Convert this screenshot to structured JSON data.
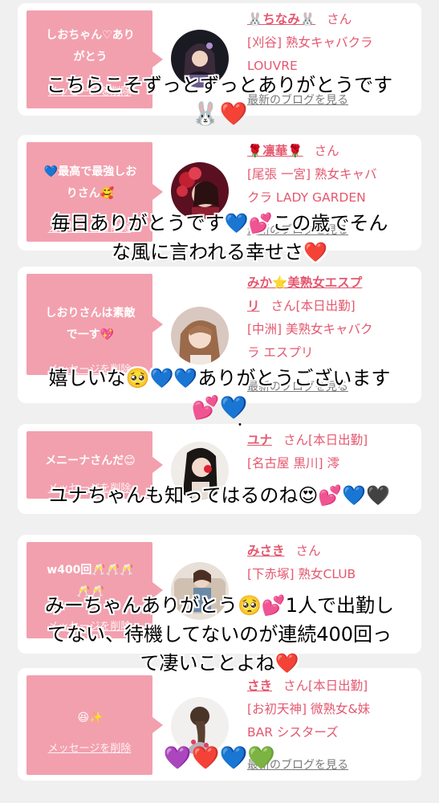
{
  "delete_label": "メッセージを削除",
  "blog_label": "最新のブログを見る",
  "san_label": "さん",
  "cards": [
    {
      "message_lines": [
        "しおちゃん♡あり",
        "がとう"
      ],
      "name": "🐰ちなみ🐰",
      "info_line1": "[刈谷] 熟女キャバクラ",
      "info_line2": "LOUVRE",
      "reply_lines": [
        "こちらこそずっとずっとありがとうです"
      ],
      "reply_emoji": "🐰❤️"
    },
    {
      "message_lines": [
        "💙最高で最強しお",
        "りさん🥰"
      ],
      "name": "🌹凛華🌹",
      "info_line1": "[尾張 一宮] 熟女キャバ",
      "info_line2": "クラ LADY GARDEN",
      "reply_lines": [
        "毎日ありがとうです💙💕この歳でそん",
        "な風に言われる幸せさ❤️"
      ]
    },
    {
      "message_lines": [
        "しおりさんは素敵",
        "で一す💖"
      ],
      "name": "みか⭐美熟女エスプ",
      "name_line2": "リ",
      "status": "[本日出勤]",
      "info_line1": "[中洲] 美熟女キャバク",
      "info_line2": "ラ エスプリ",
      "reply_lines": [
        "嬉しいな🥺💙💙ありがとうございます"
      ],
      "reply_emoji": "💕💙"
    },
    {
      "message_lines": [
        "メニーナさんだ😊"
      ],
      "name": "ユナ",
      "status": "[本日出勤]",
      "info_line1": "[名古屋 黒川] 澪",
      "reply_lines": [
        "ユナちゃんも知ってはるのね😍💕💙🖤"
      ]
    },
    {
      "message_lines": [
        "w400回🥂🥂🥂",
        "🥂🥂"
      ],
      "name": "みさき",
      "info_line1": "[下赤塚] 熟女CLUB",
      "reply_lines": [
        "みーちゃんありがとう🥺💕1人で出勤し",
        "てない、待機してないのが連続400回っ",
        "て凄いことよね❤️"
      ]
    },
    {
      "message_lines": [
        "😆✨"
      ],
      "name": "さき",
      "status": "[本日出勤]",
      "info_line1": "[お初天神] 微熟女&妹",
      "info_line2": "BAR シスターズ",
      "reply_emoji": "💜❤️💙💚"
    }
  ],
  "colors": {
    "bubble": "#f2a0ae",
    "accent": "#e4586f",
    "background": "#f0f0f0"
  }
}
